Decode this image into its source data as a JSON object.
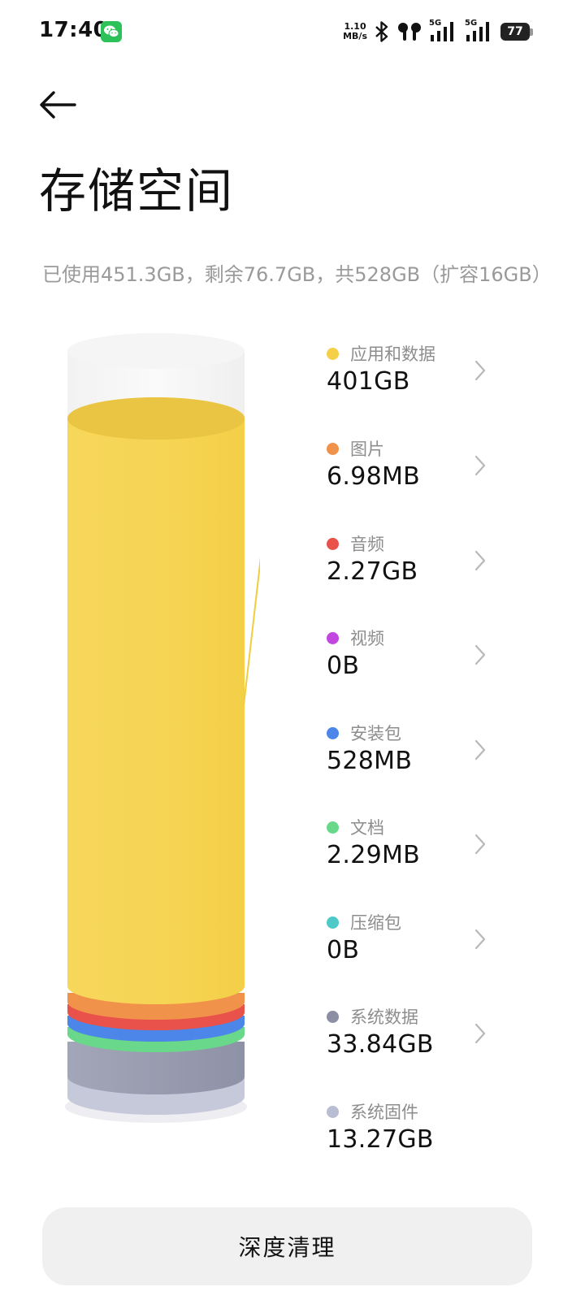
{
  "status_bar": {
    "time": "17:40",
    "net_speed_value": "1.10",
    "net_speed_unit": "MB/s",
    "sim1_type": "5G",
    "sim2_type": "5G",
    "battery_level": "77",
    "icons": [
      "wechat-icon",
      "bluetooth-icon",
      "earbuds-icon",
      "signal-icon",
      "signal-icon",
      "battery-icon"
    ]
  },
  "header": {
    "title": "存储空间",
    "summary": "已使用451.3GB，剩余76.7GB，共528GB（扩容16GB）"
  },
  "storage": {
    "used_gb": 451.3,
    "free_gb": 76.7,
    "total_gb": 528,
    "categories": [
      {
        "label": "应用和数据",
        "value": "401GB",
        "color": "#f5cf47",
        "chevron": true
      },
      {
        "label": "图片",
        "value": "6.98MB",
        "color": "#f1924a",
        "chevron": true
      },
      {
        "label": "音频",
        "value": "2.27GB",
        "color": "#e8524a",
        "chevron": true
      },
      {
        "label": "视频",
        "value": "0B",
        "color": "#c246e0",
        "chevron": true
      },
      {
        "label": "安装包",
        "value": "528MB",
        "color": "#4b86e8",
        "chevron": true
      },
      {
        "label": "文档",
        "value": "2.29MB",
        "color": "#6ad88b",
        "chevron": true
      },
      {
        "label": "压缩包",
        "value": "0B",
        "color": "#4ec9c8",
        "chevron": true
      },
      {
        "label": "系统数据",
        "value": "33.84GB",
        "color": "#8c8fa3",
        "chevron": true
      },
      {
        "label": "系统固件",
        "value": "13.27GB",
        "color": "#b9bdd1",
        "chevron": false
      }
    ]
  },
  "actions": {
    "deep_clean": "深度清理"
  }
}
